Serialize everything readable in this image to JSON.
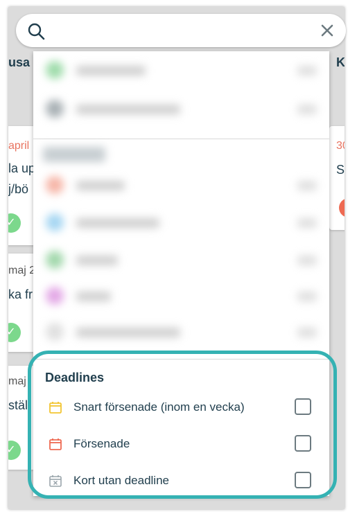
{
  "background": {
    "left_column_header": "usa",
    "right_column_header": "K",
    "left_cards": [
      {
        "date": "april",
        "title_lines": [
          "la up",
          "j/bö"
        ],
        "date_color": "#e8735f"
      },
      {
        "date": "maj 2",
        "title_lines": [
          "ka fr"
        ],
        "date_color": "#555555"
      },
      {
        "date": "maj",
        "title_lines": [
          "stäl"
        ],
        "date_color": "#555555"
      }
    ],
    "right_card": {
      "date": "30",
      "title": "S"
    }
  },
  "search": {
    "value": "",
    "placeholder": ""
  },
  "deadlines": {
    "title": "Deadlines",
    "items": [
      {
        "label": "Snart försenade (inom en vecka)",
        "icon": "calendar-yellow-icon",
        "color": "#f2c531",
        "checked": false
      },
      {
        "label": "Försenade",
        "icon": "calendar-red-icon",
        "color": "#ee6a52",
        "checked": false
      },
      {
        "label": "Kort utan deadline",
        "icon": "calendar-x-icon",
        "color": "#9aa5ab",
        "checked": false
      }
    ]
  },
  "colors": {
    "highlight": "#35b2b3",
    "text": "#213f4e"
  }
}
